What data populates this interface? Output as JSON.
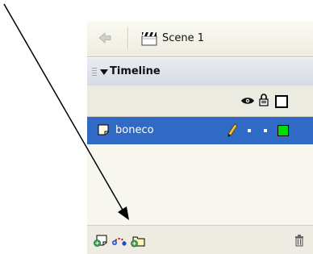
{
  "scene": {
    "label": "Scene 1"
  },
  "timeline": {
    "title": "Timeline"
  },
  "layer": {
    "name": "boneco",
    "color": "#00dd00"
  },
  "colors": {
    "selection": "#316ac5",
    "panel": "#f5f3ea"
  }
}
